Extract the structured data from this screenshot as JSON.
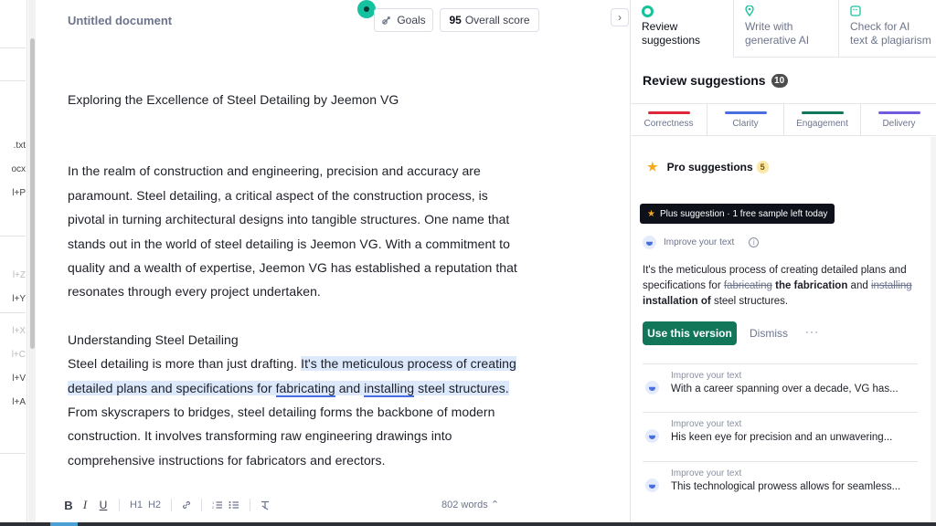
{
  "left_menu": {
    "items": [
      ".txt",
      "ocx",
      "l+P",
      "l+Z",
      "l+Y",
      "l+X",
      "l+C",
      "l+V",
      "l+A"
    ]
  },
  "editor": {
    "doc_title": "Untitled document",
    "goals_label": "Goals",
    "score_value": "95",
    "score_label": "Overall score",
    "heading": "Exploring the Excellence of Steel Detailing by Jeemon VG",
    "para1": "In the realm of construction and engineering, precision and accuracy are paramount. Steel detailing, a critical aspect of the construction process, is pivotal in turning architectural designs into tangible structures. One name that stands out in the world of steel detailing is Jeemon VG. With a commitment to quality and a wealth of expertise, Jeemon VG has established a reputation that resonates through every project undertaken.",
    "subheading": "Understanding Steel Detailing",
    "para2_start": "Steel detailing is more than just drafting. ",
    "para2_hl_a": "It's the meticulous process of creating detailed plans and specifications for ",
    "para2_hl_ul1": "fabricating",
    "para2_hl_and": " and ",
    "para2_hl_ul2": "installing",
    "para2_hl_b": " steel structures.",
    "para2_end": " From skyscrapers to bridges, steel detailing forms the backbone of modern construction. It involves transforming raw engineering drawings into comprehensive instructions for fabricators and erectors.",
    "word_count": "802 words"
  },
  "panel": {
    "tabs": [
      {
        "line1": "Review",
        "line2": "suggestions"
      },
      {
        "line1": "Write with",
        "line2": "generative AI"
      },
      {
        "line1": "Check for AI",
        "line2": "text & plagiarism"
      }
    ],
    "title": "Review suggestions",
    "count": "10",
    "categories": [
      {
        "label": "Correctness",
        "color": "#e0283d"
      },
      {
        "label": "Clarity",
        "color": "#4a6ee0"
      },
      {
        "label": "Engagement",
        "color": "#127659"
      },
      {
        "label": "Delivery",
        "color": "#6f5ce0"
      }
    ],
    "pro_label": "Pro suggestions",
    "pro_count": "5",
    "plus_tip": "Plus suggestion · 1 free sample left today",
    "improve_label": "Improve your text",
    "suggestion": {
      "text_a": "It's the meticulous process of creating detailed plans and specifications for ",
      "strike1": "fabricating",
      "ins1": " the fabrication",
      "text_b": " and ",
      "strike2": "installing",
      "ins2": " installation of",
      "text_c": " steel structures."
    },
    "use_button": "Use this version",
    "dismiss": "Dismiss",
    "more": "···",
    "cards": [
      {
        "label": "Improve your text",
        "text": "With a career spanning over a decade, VG has..."
      },
      {
        "label": "Improve your text",
        "text": "His keen eye for precision and an unwavering..."
      },
      {
        "label": "Improve your text",
        "text": "This technological prowess allows for seamless..."
      }
    ]
  },
  "colors": {
    "accent_green": "#127659",
    "highlight": "#dce8fb",
    "underline_blue": "#4a6ee0"
  }
}
